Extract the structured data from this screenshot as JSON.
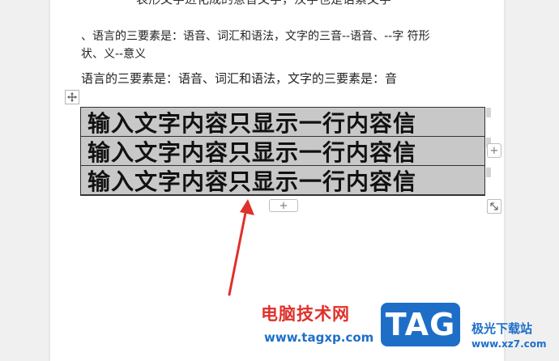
{
  "document": {
    "line_top": "表形文字进化成的意音文字，汉字也是语素文字",
    "line_a": "、语言的三要素是：语音、词汇和语法，文字的三音--语音、--字  符形",
    "line_b": "状、义--意义",
    "line_c": "语言的三要素是：语音、词汇和语法，文字的三要素是：音"
  },
  "table": {
    "rows": [
      "输入文字内容只显示一行内容信",
      "输入文字内容只显示一行内容信",
      "输入文字内容只显示一行内容信"
    ],
    "cell_background": "#c8c8c8",
    "add_column_label": "+",
    "add_row_label": "+"
  },
  "annotation": {
    "arrow_color": "#e0302b"
  },
  "watermark": {
    "site_name": "电脑技术网",
    "url": "www.tagxp.com",
    "logo_text": "TAG",
    "side_name": "极光下载站",
    "side_url": "www.xz7.com",
    "brand_color": "#1e6ec8"
  }
}
